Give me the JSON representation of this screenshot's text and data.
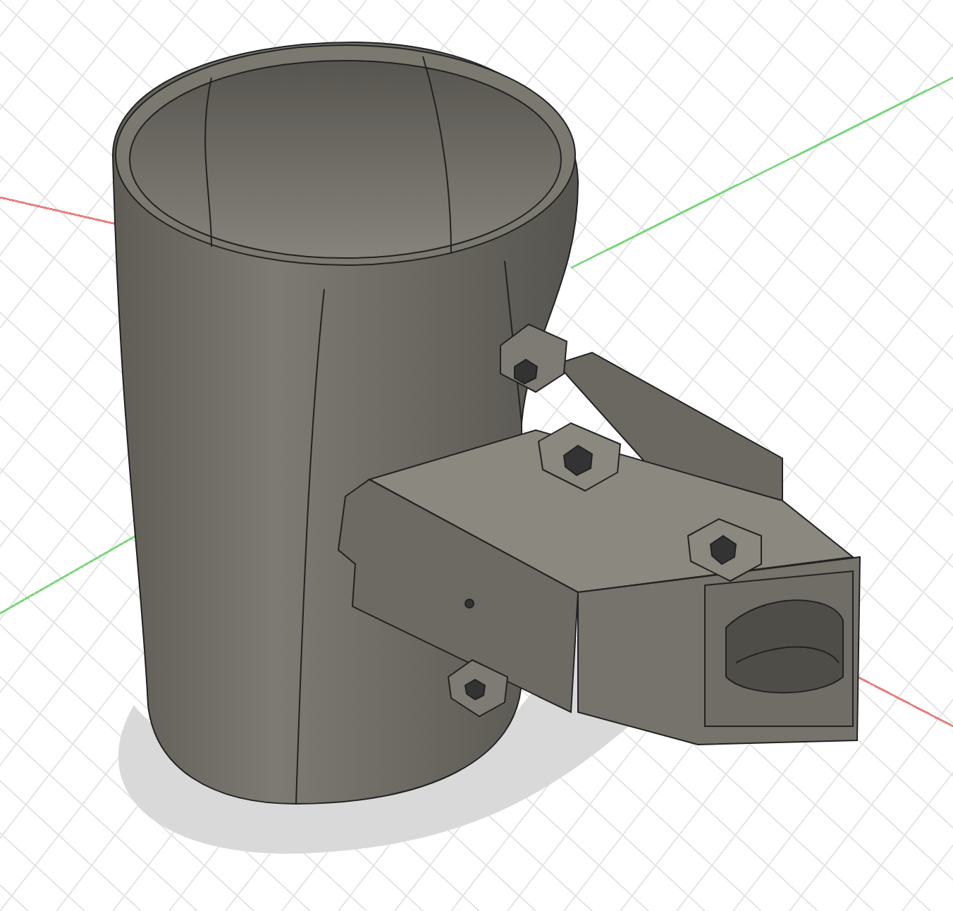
{
  "viewport": {
    "kind": "viewport",
    "axes": [
      {
        "color": "#e88080"
      },
      {
        "color": "#7fd67f"
      }
    ]
  }
}
